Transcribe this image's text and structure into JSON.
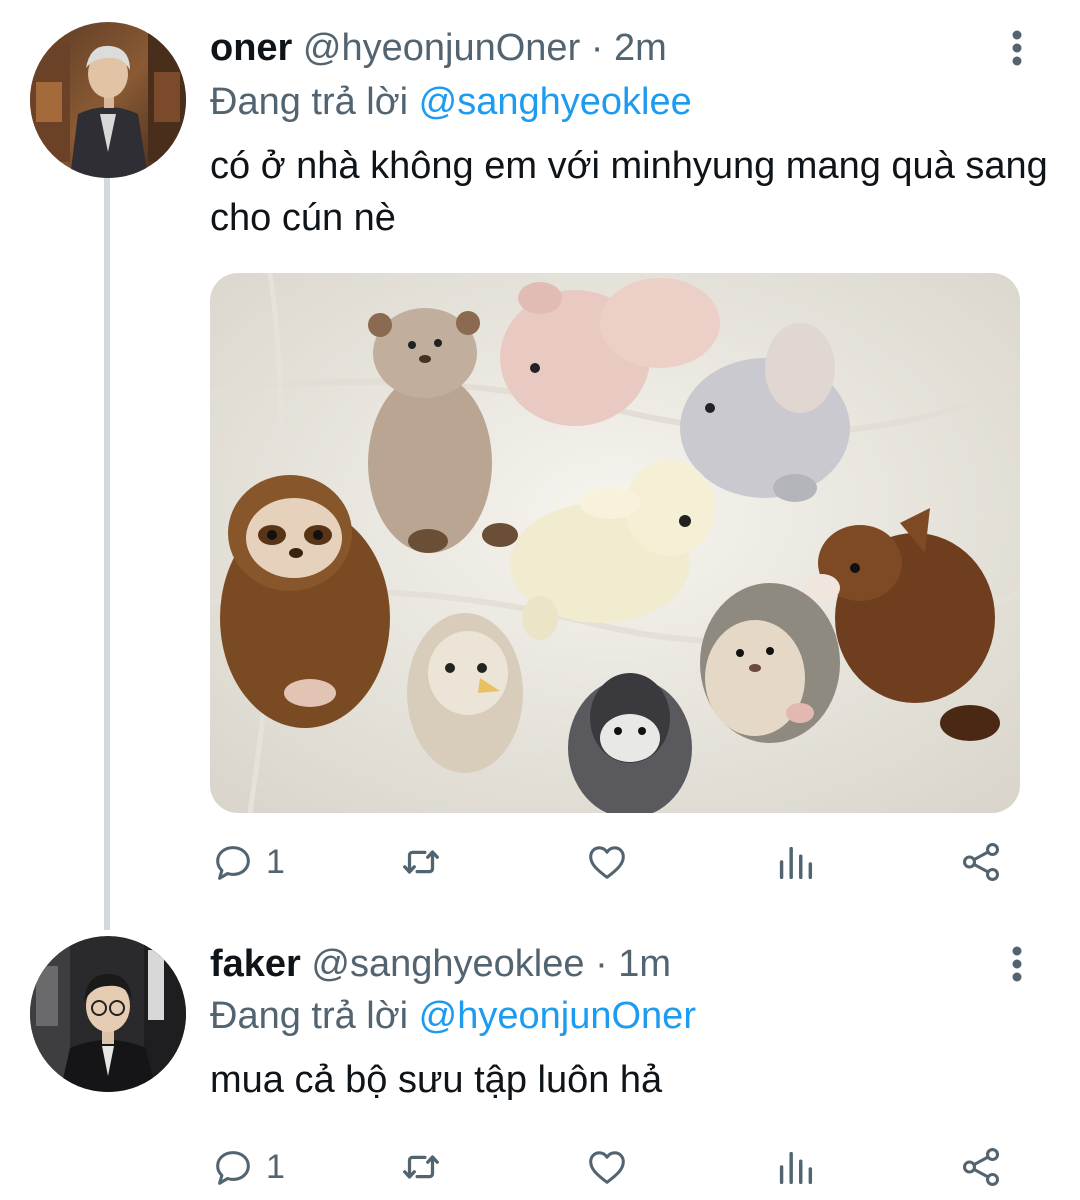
{
  "tweets": [
    {
      "name": "oner",
      "handle": "@hyeonjunOner",
      "separator": "·",
      "time": "2m",
      "replying_prefix": "Đang trả lời",
      "replying_to": "@sanghyeoklee",
      "text": "có ở nhà không em với minhyung mang quà sang cho cún nè",
      "has_media": true,
      "reply_count": "1"
    },
    {
      "name": "faker",
      "handle": "@sanghyeoklee",
      "separator": "·",
      "time": "1m",
      "replying_prefix": "Đang trả lời",
      "replying_to": "@hyeonjunOner",
      "text": "mua cả bộ sưu tập luôn hả",
      "has_media": false,
      "reply_count": "1"
    }
  ],
  "icons": {
    "reply": "reply-icon",
    "retweet": "retweet-icon",
    "like": "heart-icon",
    "views": "views-icon",
    "share": "share-icon",
    "more": "more-vertical-icon"
  },
  "colors": {
    "text": "#0f1419",
    "secondary": "#536471",
    "link": "#1d9bf0",
    "thread_line": "#cfd9de"
  }
}
